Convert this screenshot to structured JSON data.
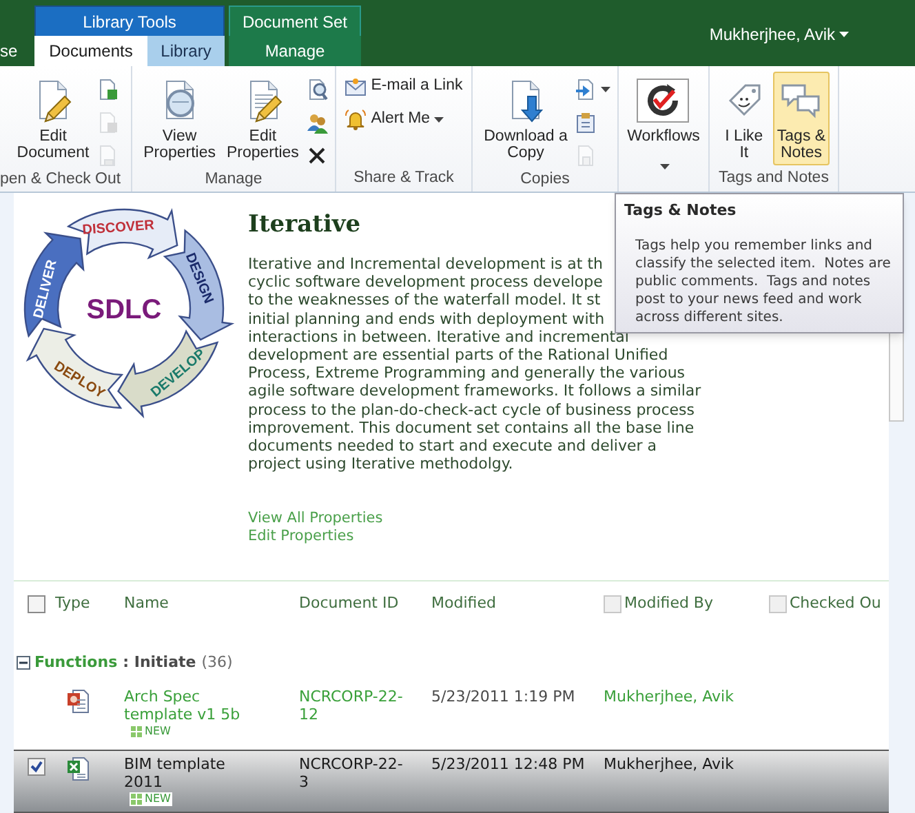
{
  "tab_bar": {
    "cut_tab": "se",
    "groups": [
      {
        "label": "Library Tools",
        "kind": "library",
        "tabs": [
          {
            "label": "Documents",
            "selected": true
          },
          {
            "label": "Library",
            "selected": false
          }
        ]
      },
      {
        "label": "Document Set",
        "kind": "docset",
        "tabs": [
          {
            "label": "Manage",
            "selected": false
          }
        ]
      }
    ],
    "user_menu": "Mukherjhee, Avik"
  },
  "ribbon": {
    "groups": [
      {
        "label": "pen & Check Out",
        "buttons": [
          {
            "kind": "large",
            "label": [
              "Edit",
              "Document"
            ],
            "disabled": false,
            "dropdown": false,
            "highlighted": false
          },
          {
            "kind": "icon",
            "disabled": false,
            "dropdown": false
          },
          {
            "kind": "icon",
            "disabled": true,
            "dropdown": false
          },
          {
            "kind": "icon",
            "disabled": true,
            "dropdown": false
          }
        ]
      },
      {
        "label": "Manage",
        "buttons": [
          {
            "kind": "large",
            "label": [
              "View",
              "Properties"
            ],
            "disabled": false,
            "dropdown": false,
            "highlighted": false
          },
          {
            "kind": "large",
            "label": [
              "Edit",
              "Properties"
            ],
            "disabled": false,
            "dropdown": false,
            "highlighted": false
          },
          {
            "kind": "icon",
            "disabled": false,
            "dropdown": false
          },
          {
            "kind": "icon",
            "disabled": false,
            "dropdown": false
          },
          {
            "kind": "icon",
            "disabled": false,
            "dropdown": false
          }
        ]
      },
      {
        "label": "Share & Track",
        "buttons": [
          {
            "kind": "small",
            "label": "E-mail a Link",
            "disabled": false,
            "dropdown": false
          },
          {
            "kind": "small",
            "label": "Alert Me",
            "disabled": false,
            "dropdown": true
          }
        ]
      },
      {
        "label": "Copies",
        "buttons": [
          {
            "kind": "large",
            "label": [
              "Download a",
              "Copy"
            ],
            "disabled": false,
            "dropdown": false,
            "highlighted": false
          },
          {
            "kind": "icon",
            "disabled": false,
            "dropdown": true
          },
          {
            "kind": "icon",
            "disabled": false,
            "dropdown": false
          },
          {
            "kind": "icon",
            "disabled": true,
            "dropdown": false
          }
        ]
      },
      {
        "buttons": [
          {
            "kind": "large",
            "label": [
              "Workflows"
            ],
            "disabled": false,
            "dropdown": true,
            "highlighted": false
          }
        ]
      },
      {
        "label": "Tags and Notes",
        "buttons": [
          {
            "kind": "large",
            "label": [
              "I Like",
              "It"
            ],
            "disabled": false,
            "dropdown": false,
            "highlighted": false
          },
          {
            "kind": "large",
            "label": [
              "Tags &",
              "Notes"
            ],
            "disabled": false,
            "dropdown": false,
            "highlighted": true
          }
        ]
      }
    ]
  },
  "tooltip": {
    "title": "Tags & Notes",
    "body": "Tags help you remember links and classify the selected item.  Notes are public comments.  Tags and notes post to your news feed and work across different sites."
  },
  "diagram": {
    "center": "SDLC",
    "stages": [
      {
        "label": "DISCOVER",
        "color": "#c0303a"
      },
      {
        "label": "DESIGN",
        "color": "#1a2a6a"
      },
      {
        "label": "DEVELOP",
        "color": "#1a7a6a"
      },
      {
        "label": "DEPLOY",
        "color": "#8a4a10"
      },
      {
        "label": "DELIVER",
        "color": "#ffffff"
      }
    ]
  },
  "document_set": {
    "title": "Iterative",
    "description_lines": [
      "Iterative and Incremental development is at th",
      "cyclic software development process develope",
      "to the weaknesses of the waterfall model. It st",
      "initial planning and ends with deployment with",
      "interactions in between. Iterative and incremental",
      "development are essential parts of the Rational Unified",
      "Process, Extreme Programming and generally the various",
      "agile software development frameworks. It follows a similar",
      "process to the plan-do-check-act cycle of business process",
      "improvement. This document set contains all the base line",
      "documents needed to start and execute and deliver a",
      "project using Iterative methodolgy."
    ],
    "links": [
      "View All Properties",
      "Edit Properties"
    ]
  },
  "table": {
    "select_all": {
      "checked": false
    },
    "columns": [
      {
        "label": "Type"
      },
      {
        "label": "Name"
      },
      {
        "label": "Document ID"
      },
      {
        "label": "Modified"
      },
      {
        "label": "Modified By",
        "checkbox": {
          "checked": false
        }
      },
      {
        "label": "Checked Ou",
        "checkbox": {
          "checked": false
        }
      }
    ],
    "groups": [
      {
        "field": "Functions",
        "value": ": Initiate",
        "count": "(36)",
        "expanded": true,
        "rows": [
          {
            "kind": "presentation",
            "selected": false,
            "name": "Arch Spec template v1 5b",
            "badge": "NEW",
            "document_id": "NCRCORP-22-12",
            "modified": "5/23/2011 1:19 PM",
            "modified_by": "Mukherjhee, Avik"
          },
          {
            "kind": "spreadsheet",
            "selected": true,
            "name": "BIM template 2011",
            "badge": "NEW",
            "document_id": "NCRCORP-22-3",
            "modified": "5/23/2011 12:48 PM",
            "modified_by": "Mukherjhee, Avik"
          }
        ]
      }
    ]
  }
}
